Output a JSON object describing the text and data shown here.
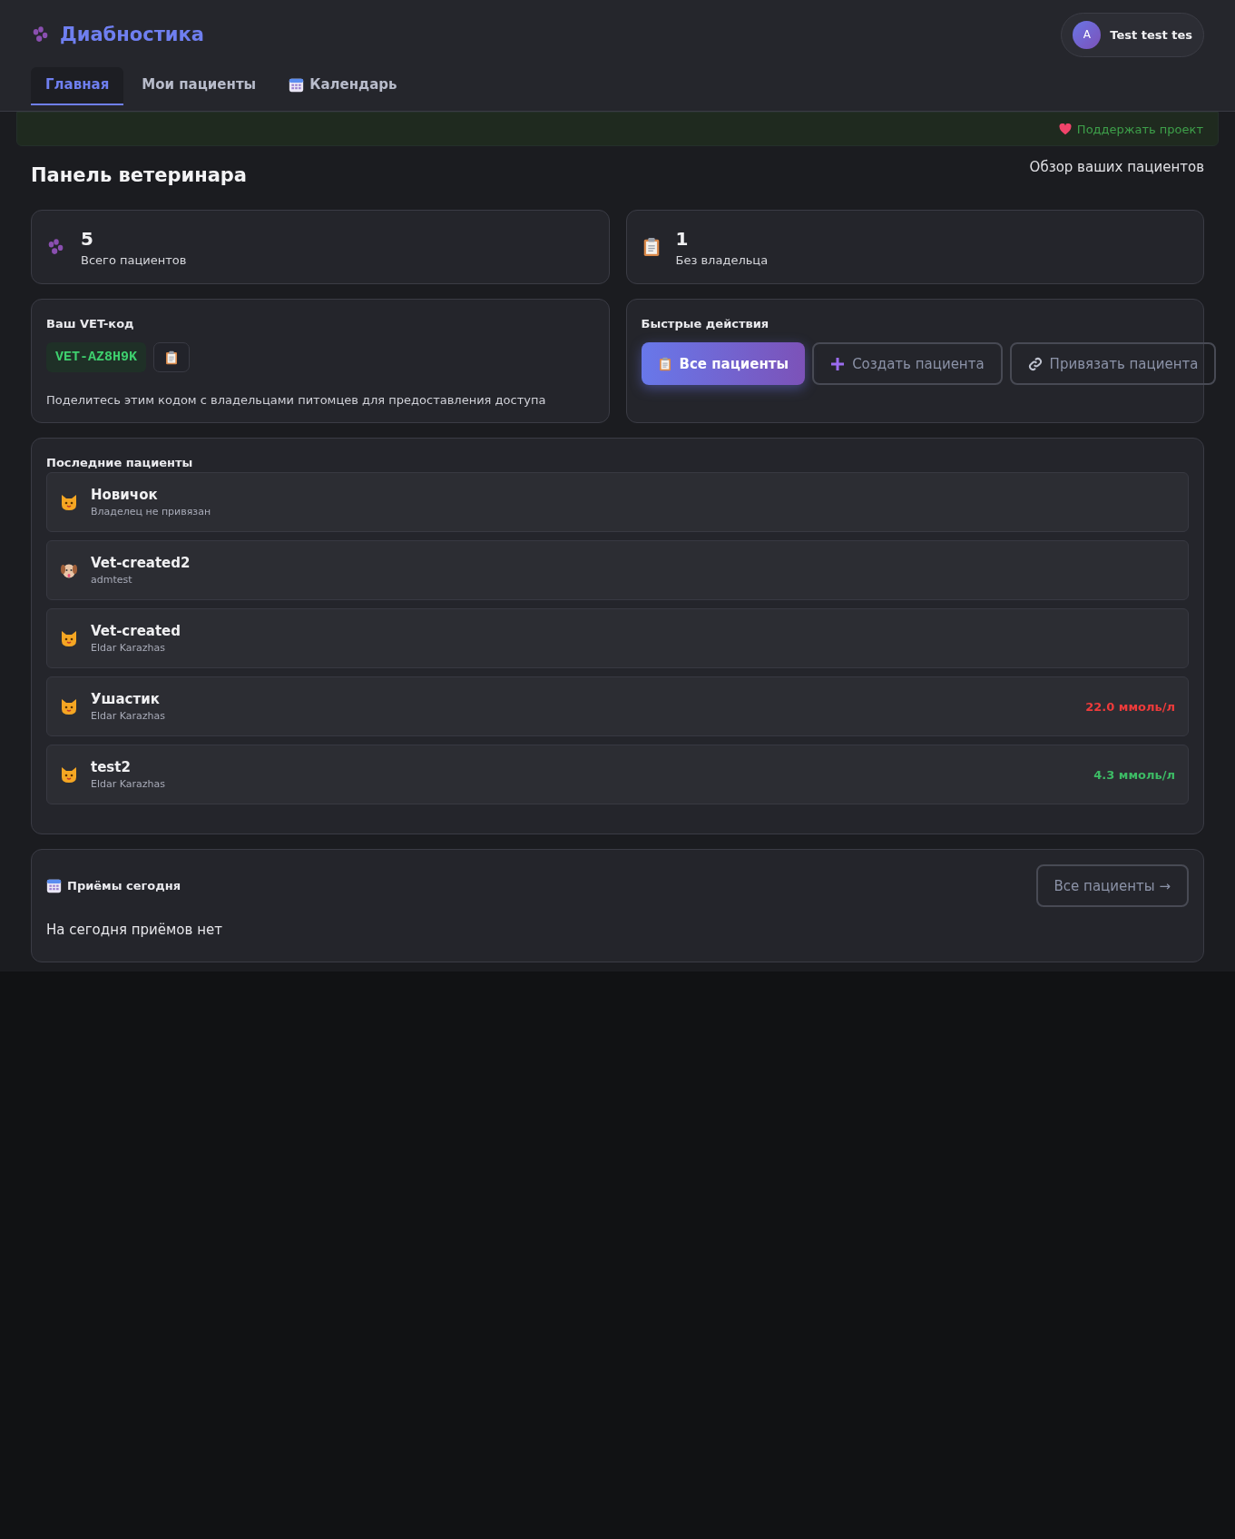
{
  "header": {
    "logo": "Диабностика",
    "user": {
      "avatar_letter": "A",
      "name": "Test test tes"
    }
  },
  "tabs": [
    {
      "kind": "plain",
      "label": "Главная",
      "selected": true
    },
    {
      "kind": "plain",
      "label": "Мои пациенты",
      "selected": false
    },
    {
      "kind": "calendar",
      "label": "Календарь",
      "selected": false
    }
  ],
  "support_banner": {
    "label": "Поддержать проект"
  },
  "page": {
    "title": "Панель ветеринара",
    "subtitle": "Обзор ваших пациентов"
  },
  "stats": [
    {
      "kind": "paw",
      "value": "5",
      "label": "Всего пациентов"
    },
    {
      "kind": "clipboard",
      "value": "1",
      "label": "Без владельца"
    }
  ],
  "vet_code": {
    "title": "Ваш VET-код",
    "code": "VET-AZ8H9K",
    "hint": "Поделитесь этим кодом с владельцами питомцев для предоставления доступа"
  },
  "quick_actions": {
    "title": "Быстрые действия",
    "buttons": [
      {
        "kind": "list",
        "label": "Все пациенты"
      },
      {
        "kind": "create",
        "label": "Создать пациента"
      },
      {
        "kind": "link",
        "label": "Привязать пациента"
      }
    ]
  },
  "recent_patients": {
    "title": "Последние пациенты",
    "items": [
      {
        "kind": "cat",
        "name": "Новичок",
        "owner": "Владелец не привязан"
      },
      {
        "kind": "dog",
        "name": "Vet-created2",
        "owner": "admtest"
      },
      {
        "kind": "cat",
        "name": "Vet-created",
        "owner": "Eldar Karazhas"
      },
      {
        "kind": "cat",
        "name": "Ушастик",
        "owner": "Eldar Karazhas",
        "glucose": "22.0 ммоль/л",
        "color": "#ee3b3b"
      },
      {
        "kind": "cat",
        "name": "test2",
        "owner": "Eldar Karazhas",
        "glucose": "4.3 ммоль/л",
        "color": "#3dbb65"
      }
    ]
  },
  "appointments": {
    "title": "Приёмы сегодня",
    "button": "Все пациенты →",
    "empty": "На сегодня приёмов нет"
  }
}
